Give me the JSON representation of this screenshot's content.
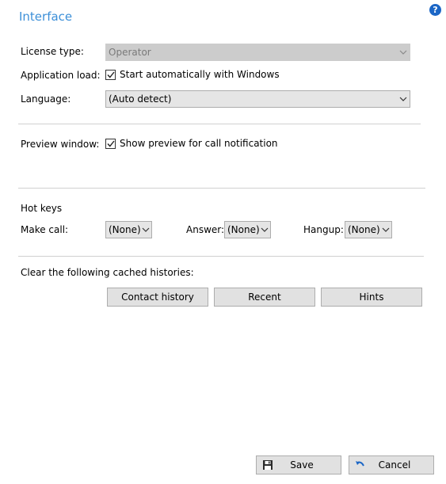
{
  "page": {
    "title": "Interface",
    "help_label": "?"
  },
  "license": {
    "label": "License type:",
    "value": "Operator"
  },
  "app_load": {
    "label": "Application load:",
    "checkbox_label": "Start automatically with Windows",
    "checked": true
  },
  "language": {
    "label": "Language:",
    "value": "(Auto detect)"
  },
  "preview": {
    "label": "Preview window:",
    "checkbox_label": "Show preview for call notification",
    "checked": true
  },
  "hotkeys": {
    "heading": "Hot keys",
    "make_call_label": "Make call:",
    "make_call_value": "(None)",
    "answer_label": "Answer:",
    "answer_value": "(None)",
    "hangup_label": "Hangup:",
    "hangup_value": "(None)"
  },
  "cache": {
    "heading": "Clear the following cached histories:",
    "contact_history": "Contact history",
    "recent": "Recent",
    "hints": "Hints"
  },
  "footer": {
    "save": "Save",
    "cancel": "Cancel"
  },
  "colors": {
    "title": "#3c8fd8",
    "help_bg": "#1b66c6",
    "button_bg": "#e1e1e1",
    "select_bg": "#e5e5e5",
    "disabled_bg": "#cccccc"
  },
  "icons": {
    "help": "help-icon",
    "chevron": "chevron-down-icon",
    "check": "checkmark-icon",
    "save": "floppy-disk-icon",
    "cancel": "undo-arrow-icon"
  }
}
